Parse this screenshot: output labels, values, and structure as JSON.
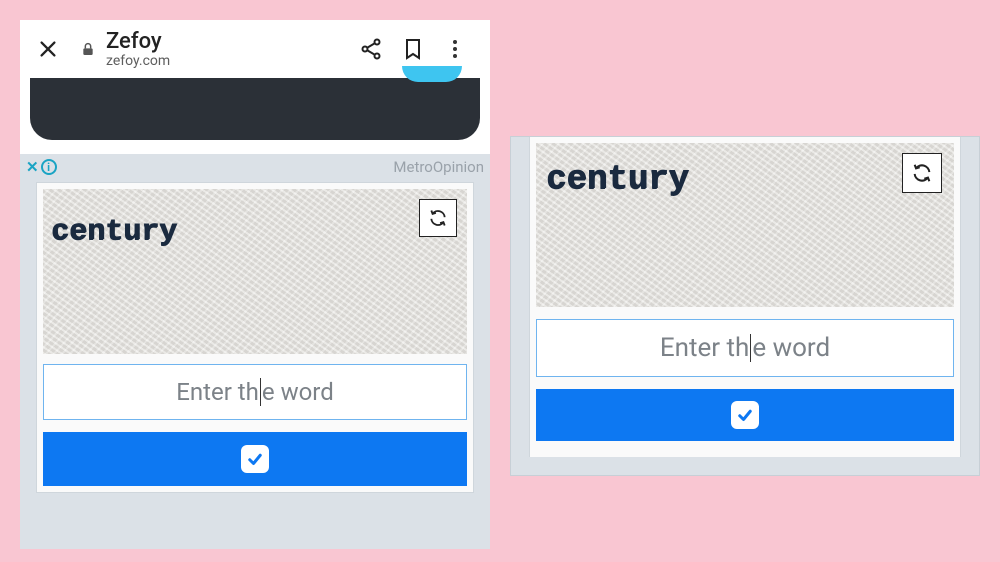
{
  "browser": {
    "site_title": "Zefoy",
    "site_domain": "zefoy.com"
  },
  "ad": {
    "close_glyph": "✕",
    "info_glyph": "i",
    "label": "MetroOpinion"
  },
  "captcha": {
    "word": "century",
    "placeholder_pre": "Enter th",
    "placeholder_post": "e word"
  },
  "right": {
    "captcha_word": "century",
    "placeholder_pre": "Enter th",
    "placeholder_post": "e word"
  },
  "colors": {
    "accent_blue": "#0d78f2",
    "pink_bg": "#f9c6d2"
  }
}
